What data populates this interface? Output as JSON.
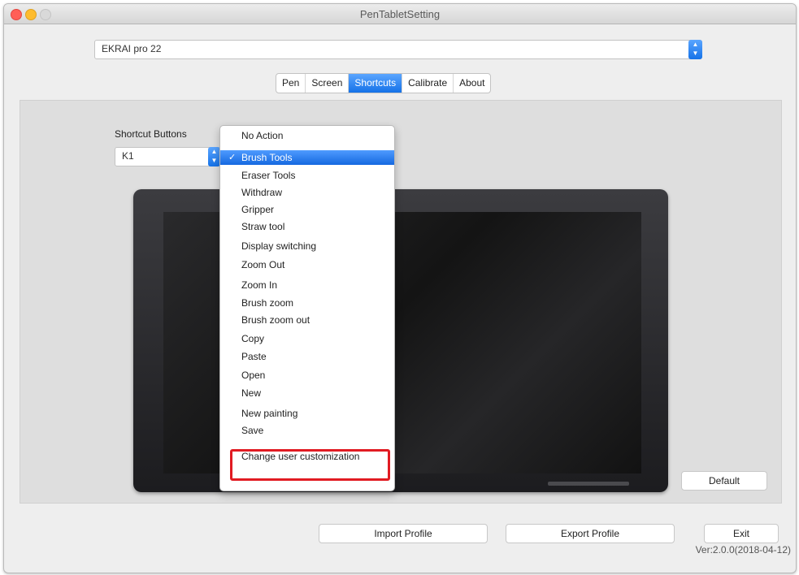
{
  "window": {
    "title": "PenTabletSetting"
  },
  "device_select": {
    "value": "EKRAI pro 22"
  },
  "tabs": [
    {
      "label": "Pen",
      "active": false
    },
    {
      "label": "Screen",
      "active": false
    },
    {
      "label": "Shortcuts",
      "active": true
    },
    {
      "label": "Calibrate",
      "active": false
    },
    {
      "label": "About",
      "active": false
    }
  ],
  "shortcut": {
    "label": "Shortcut Buttons",
    "selected_key": "K1"
  },
  "dropdown": {
    "selected_index": 1,
    "options": [
      "No Action",
      "Brush Tools",
      "Eraser Tools",
      "Withdraw",
      "Gripper",
      "Straw tool",
      "Display switching",
      "Zoom Out",
      "Zoom In",
      "Brush zoom",
      "Brush zoom out",
      "Copy",
      "Paste",
      "Open",
      "New",
      "New painting",
      "Save",
      "Change user customization"
    ]
  },
  "buttons": {
    "default": "Default",
    "import": "Import Profile",
    "export": "Export Profile",
    "exit": "Exit"
  },
  "version": "Ver:2.0.0(2018-04-12)",
  "colors": {
    "accent": "#1572e8",
    "highlight": "#e11b22"
  }
}
